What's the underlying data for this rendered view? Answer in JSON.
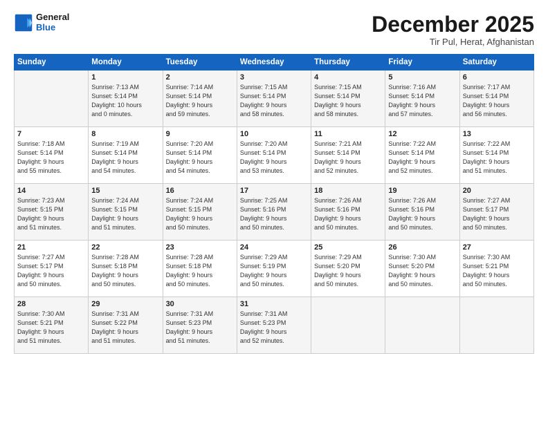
{
  "header": {
    "logo_line1": "General",
    "logo_line2": "Blue",
    "month": "December 2025",
    "location": "Tir Pul, Herat, Afghanistan"
  },
  "days_of_week": [
    "Sunday",
    "Monday",
    "Tuesday",
    "Wednesday",
    "Thursday",
    "Friday",
    "Saturday"
  ],
  "weeks": [
    [
      {
        "day": "",
        "detail": ""
      },
      {
        "day": "1",
        "detail": "Sunrise: 7:13 AM\nSunset: 5:14 PM\nDaylight: 10 hours\nand 0 minutes."
      },
      {
        "day": "2",
        "detail": "Sunrise: 7:14 AM\nSunset: 5:14 PM\nDaylight: 9 hours\nand 59 minutes."
      },
      {
        "day": "3",
        "detail": "Sunrise: 7:15 AM\nSunset: 5:14 PM\nDaylight: 9 hours\nand 58 minutes."
      },
      {
        "day": "4",
        "detail": "Sunrise: 7:15 AM\nSunset: 5:14 PM\nDaylight: 9 hours\nand 58 minutes."
      },
      {
        "day": "5",
        "detail": "Sunrise: 7:16 AM\nSunset: 5:14 PM\nDaylight: 9 hours\nand 57 minutes."
      },
      {
        "day": "6",
        "detail": "Sunrise: 7:17 AM\nSunset: 5:14 PM\nDaylight: 9 hours\nand 56 minutes."
      }
    ],
    [
      {
        "day": "7",
        "detail": "Sunrise: 7:18 AM\nSunset: 5:14 PM\nDaylight: 9 hours\nand 55 minutes."
      },
      {
        "day": "8",
        "detail": "Sunrise: 7:19 AM\nSunset: 5:14 PM\nDaylight: 9 hours\nand 54 minutes."
      },
      {
        "day": "9",
        "detail": "Sunrise: 7:20 AM\nSunset: 5:14 PM\nDaylight: 9 hours\nand 54 minutes."
      },
      {
        "day": "10",
        "detail": "Sunrise: 7:20 AM\nSunset: 5:14 PM\nDaylight: 9 hours\nand 53 minutes."
      },
      {
        "day": "11",
        "detail": "Sunrise: 7:21 AM\nSunset: 5:14 PM\nDaylight: 9 hours\nand 52 minutes."
      },
      {
        "day": "12",
        "detail": "Sunrise: 7:22 AM\nSunset: 5:14 PM\nDaylight: 9 hours\nand 52 minutes."
      },
      {
        "day": "13",
        "detail": "Sunrise: 7:22 AM\nSunset: 5:14 PM\nDaylight: 9 hours\nand 51 minutes."
      }
    ],
    [
      {
        "day": "14",
        "detail": "Sunrise: 7:23 AM\nSunset: 5:15 PM\nDaylight: 9 hours\nand 51 minutes."
      },
      {
        "day": "15",
        "detail": "Sunrise: 7:24 AM\nSunset: 5:15 PM\nDaylight: 9 hours\nand 51 minutes."
      },
      {
        "day": "16",
        "detail": "Sunrise: 7:24 AM\nSunset: 5:15 PM\nDaylight: 9 hours\nand 50 minutes."
      },
      {
        "day": "17",
        "detail": "Sunrise: 7:25 AM\nSunset: 5:16 PM\nDaylight: 9 hours\nand 50 minutes."
      },
      {
        "day": "18",
        "detail": "Sunrise: 7:26 AM\nSunset: 5:16 PM\nDaylight: 9 hours\nand 50 minutes."
      },
      {
        "day": "19",
        "detail": "Sunrise: 7:26 AM\nSunset: 5:16 PM\nDaylight: 9 hours\nand 50 minutes."
      },
      {
        "day": "20",
        "detail": "Sunrise: 7:27 AM\nSunset: 5:17 PM\nDaylight: 9 hours\nand 50 minutes."
      }
    ],
    [
      {
        "day": "21",
        "detail": "Sunrise: 7:27 AM\nSunset: 5:17 PM\nDaylight: 9 hours\nand 50 minutes."
      },
      {
        "day": "22",
        "detail": "Sunrise: 7:28 AM\nSunset: 5:18 PM\nDaylight: 9 hours\nand 50 minutes."
      },
      {
        "day": "23",
        "detail": "Sunrise: 7:28 AM\nSunset: 5:18 PM\nDaylight: 9 hours\nand 50 minutes."
      },
      {
        "day": "24",
        "detail": "Sunrise: 7:29 AM\nSunset: 5:19 PM\nDaylight: 9 hours\nand 50 minutes."
      },
      {
        "day": "25",
        "detail": "Sunrise: 7:29 AM\nSunset: 5:20 PM\nDaylight: 9 hours\nand 50 minutes."
      },
      {
        "day": "26",
        "detail": "Sunrise: 7:30 AM\nSunset: 5:20 PM\nDaylight: 9 hours\nand 50 minutes."
      },
      {
        "day": "27",
        "detail": "Sunrise: 7:30 AM\nSunset: 5:21 PM\nDaylight: 9 hours\nand 50 minutes."
      }
    ],
    [
      {
        "day": "28",
        "detail": "Sunrise: 7:30 AM\nSunset: 5:21 PM\nDaylight: 9 hours\nand 51 minutes."
      },
      {
        "day": "29",
        "detail": "Sunrise: 7:31 AM\nSunset: 5:22 PM\nDaylight: 9 hours\nand 51 minutes."
      },
      {
        "day": "30",
        "detail": "Sunrise: 7:31 AM\nSunset: 5:23 PM\nDaylight: 9 hours\nand 51 minutes."
      },
      {
        "day": "31",
        "detail": "Sunrise: 7:31 AM\nSunset: 5:23 PM\nDaylight: 9 hours\nand 52 minutes."
      },
      {
        "day": "",
        "detail": ""
      },
      {
        "day": "",
        "detail": ""
      },
      {
        "day": "",
        "detail": ""
      }
    ]
  ]
}
